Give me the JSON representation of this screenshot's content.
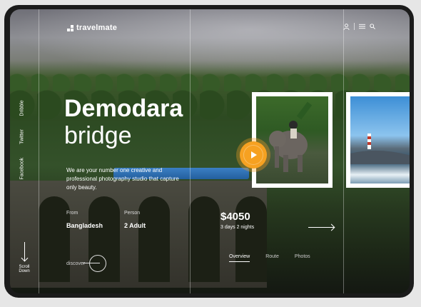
{
  "brand": {
    "name": "travelmate"
  },
  "hero": {
    "title_bold": "Demodara",
    "title_light": "bridge",
    "description": "We are your number one creative and professional photography studio that capture only beauty."
  },
  "social": [
    "Dribble",
    "Twitter",
    "Facebook"
  ],
  "trip": {
    "from_label": "From",
    "from_value": "Bangladesh",
    "person_label": "Person",
    "person_value": "2 Adult",
    "price": "$4050",
    "duration": "3 days 2 nights"
  },
  "discover_label": "discover",
  "scroll": {
    "line1": "Scroll",
    "line2": "Down"
  },
  "tabs": [
    "Overview",
    "Route",
    "Photos"
  ],
  "icons": {
    "user": "user-icon",
    "menu": "menu-icon",
    "search": "search-icon",
    "play": "play-icon"
  },
  "colors": {
    "accent": "#f6a121"
  }
}
